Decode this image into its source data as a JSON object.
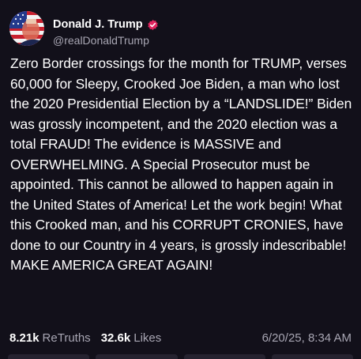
{
  "post": {
    "author": {
      "display_name": "Donald J. Trump",
      "handle": "@realDonaldTrump",
      "verified_icon": "verified-badge-icon",
      "verified_color": "#e0245e"
    },
    "text": "Zero Border crossings for the month for TRUMP, verses 60,000 for Sleepy, Crooked Joe Biden, a man who lost the 2020 Presidential Election by a “LANDSLIDE!” Biden was grossly incompetent, and the 2020 election was a total FRAUD! The evidence is MASSIVE and OVERWHELMING. A Special Prosecutor must be appointed. This cannot be allowed to happen again in the United States of America! Let the work begin! What this Crooked man, and his CORRUPT CRONIES, have done to our Country in 4 years, is grossly indescribable! MAKE AMERICA GREAT AGAIN!",
    "stats": {
      "retruths_count": "8.21k",
      "retruths_label": "ReTruths",
      "likes_count": "32.6k",
      "likes_label": "Likes"
    },
    "timestamp": "6/20/25, 8:34 AM"
  },
  "colors": {
    "background": "#12101a",
    "text_primary": "#ffffff",
    "text_secondary": "#a8a6b3"
  }
}
